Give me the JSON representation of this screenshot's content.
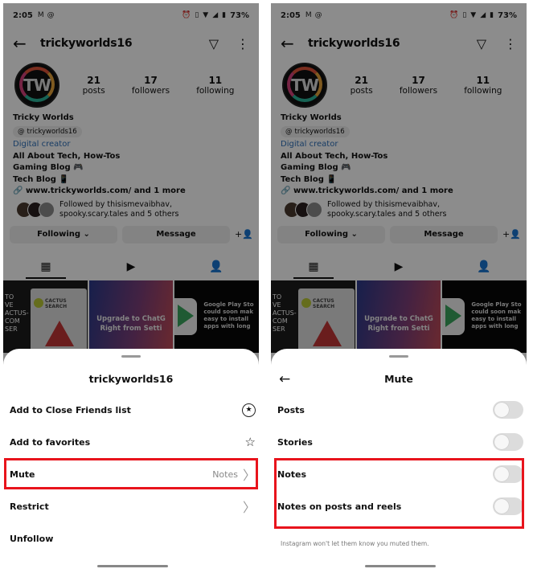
{
  "status_bar": {
    "time": "2:05",
    "left_icons": [
      "gmail-icon",
      "threads-icon"
    ],
    "right_icons": [
      "alarm-icon",
      "vibrate-icon",
      "volte-icon",
      "wifi-icon",
      "signal-icon",
      "battery-icon"
    ],
    "battery": "73%"
  },
  "profile": {
    "username": "trickyworlds16",
    "avatar_text": "TW",
    "stats": [
      {
        "value": "21",
        "label": "posts"
      },
      {
        "value": "17",
        "label": "followers"
      },
      {
        "value": "11",
        "label": "following"
      }
    ],
    "display_name": "Tricky Worlds",
    "threads_handle": "trickyworlds16",
    "category": "Digital creator",
    "bio_lines": [
      "All About Tech, How-Tos",
      "Gaming Blog 🎮",
      "Tech Blog 📱"
    ],
    "link": "www.trickyworlds.com/ and 1 more",
    "followed_by_line1": "Followed by thisismevaibhav,",
    "followed_by_line2": "spooky.scary.tales and 5 others",
    "following_button": "Following ⌄",
    "message_button": "Message",
    "add_user_icon": "+👤"
  },
  "posts": {
    "post1_side": [
      "TO",
      "VE",
      "ACTUS-",
      "COM",
      "SER"
    ],
    "post1_card": "CACTUS SEARCH",
    "post2_lines": [
      "Upgrade to ChatG",
      "Right from Setti"
    ],
    "post3_lines": [
      "Google Play Sto",
      "could soon mak",
      "easy to install",
      "apps with long"
    ]
  },
  "left_sheet": {
    "title": "trickyworlds16",
    "items": [
      {
        "label": "Add to Close Friends list",
        "icon": "close-friends-star-icon"
      },
      {
        "label": "Add to favorites",
        "icon": "star-outline-icon"
      },
      {
        "label": "Mute",
        "hint": "Notes",
        "icon": "chevron-right-icon"
      },
      {
        "label": "Restrict",
        "icon": "chevron-right-icon"
      },
      {
        "label": "Unfollow"
      }
    ]
  },
  "right_sheet": {
    "title": "Mute",
    "items": [
      {
        "label": "Posts",
        "on": false
      },
      {
        "label": "Stories",
        "on": false
      },
      {
        "label": "Notes",
        "on": false
      },
      {
        "label": "Notes on posts and reels",
        "on": false
      }
    ],
    "footer_note": "Instagram won't let them know you muted them."
  },
  "highlight_color": "#e8141c"
}
